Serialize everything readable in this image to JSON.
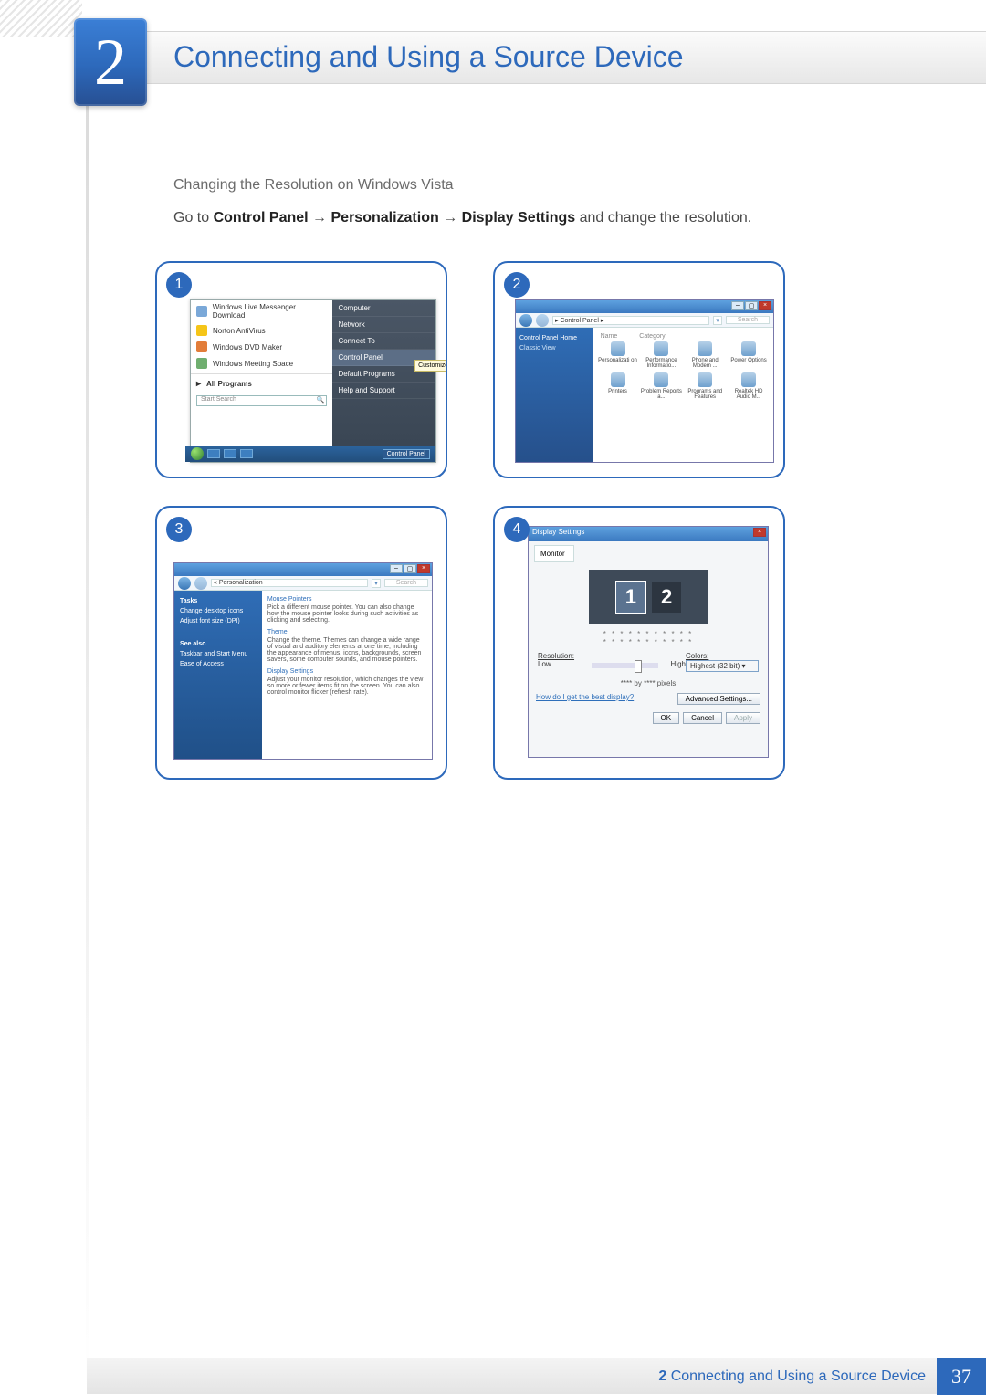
{
  "chapter": {
    "number": "2",
    "title": "Connecting and Using a Source Device"
  },
  "section": {
    "subhead": "Changing the Resolution on Windows Vista",
    "instruction_parts": {
      "p0": "Go to ",
      "b0": "Control Panel",
      "arrow": " → ",
      "b1": "Personalization",
      "b2": "Display Settings",
      "p1": " and change the resolution."
    }
  },
  "steps": {
    "s1": "1",
    "s2": "2",
    "s3": "3",
    "s4": "4"
  },
  "step1": {
    "left_items": [
      "Windows Live Messenger Download",
      "Norton AntiVirus",
      "Windows DVD Maker",
      "Windows Meeting Space"
    ],
    "all_programs": "All Programs",
    "search_placeholder": "Start Search",
    "right_items": [
      "Computer",
      "Network",
      "Connect To",
      "Control Panel",
      "Default Programs",
      "Help and Support"
    ],
    "callout": "Customize...",
    "taskbar_label": "Control Panel"
  },
  "step2": {
    "breadcrumb": "▸ Control Panel ▸",
    "search_placeholder": "Search",
    "side": {
      "home": "Control Panel Home",
      "classic": "Classic View"
    },
    "columns": {
      "name": "Name",
      "category": "Category"
    },
    "icons": [
      "Personalizati on",
      "Performance Informatio...",
      "Phone and Modem ...",
      "Power Options",
      "Printers",
      "Problem Reports a...",
      "Programs and Features",
      "Realtek HD Audio M..."
    ]
  },
  "step3": {
    "breadcrumb": "« Personalization",
    "search_placeholder": "Search",
    "side": {
      "tasks_h": "Tasks",
      "t1": "Change desktop icons",
      "t2": "Adjust font size (DPI)",
      "see_h": "See also",
      "s1": "Taskbar and Start Menu",
      "s2": "Ease of Access"
    },
    "main": {
      "mp_h": "Mouse Pointers",
      "mp_t": "Pick a different mouse pointer. You can also change how the mouse pointer looks during such activities as clicking and selecting.",
      "th_h": "Theme",
      "th_t": "Change the theme. Themes can change a wide range of visual and auditory elements at one time, including the appearance of menus, icons, backgrounds, screen savers, some computer sounds, and mouse pointers.",
      "ds_h": "Display Settings",
      "ds_t": "Adjust your monitor resolution, which changes the view so more or fewer items fit on the screen. You can also control monitor flicker (refresh rate)."
    }
  },
  "step4": {
    "title": "Display Settings",
    "tab": "Monitor",
    "mon1": "1",
    "mon2": "2",
    "mask": "* * * * * * * * * * *",
    "res_label": "Resolution:",
    "low": "Low",
    "high": "High",
    "color_label": "Colors:",
    "color_val": "Highest (32 bit)",
    "info": "**** by **** pixels",
    "help": "How do I get the best display?",
    "adv": "Advanced Settings...",
    "ok": "OK",
    "cancel": "Cancel",
    "apply": "Apply"
  },
  "footer": {
    "text_prefix": "2",
    "text": "Connecting and Using a Source Device",
    "page": "37"
  }
}
